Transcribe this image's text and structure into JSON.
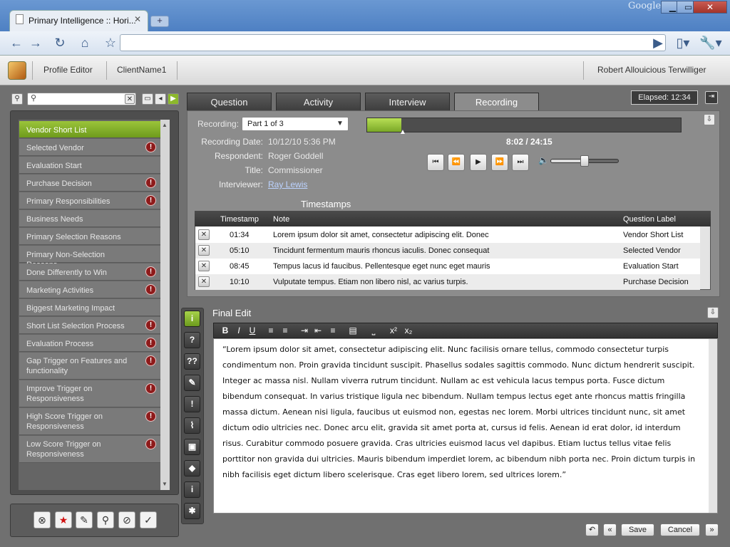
{
  "browser": {
    "tab_title": "Primary Intelligence :: Hori...",
    "brand": "Google",
    "address": "",
    "window_controls": [
      "▁",
      "▭",
      "✕"
    ]
  },
  "header": {
    "profile_editor": "Profile Editor",
    "client_name": "ClientName1",
    "user_name": "Robert Allouicious Terwilliger"
  },
  "sidebar": {
    "search_placeholder": "",
    "items": [
      {
        "label": "Vendor Short List",
        "warn": false,
        "selected": true
      },
      {
        "label": "Selected Vendor",
        "warn": true
      },
      {
        "label": "Evaluation Start",
        "warn": false
      },
      {
        "label": "Purchase Decision",
        "warn": true
      },
      {
        "label": "Primary Responsibilities",
        "warn": true
      },
      {
        "label": "Business Needs",
        "warn": false
      },
      {
        "label": "Primary Selection Reasons",
        "warn": false
      },
      {
        "label": "Primary Non-Selection Reasons",
        "warn": false
      },
      {
        "label": "Done Differently to Win",
        "warn": true
      },
      {
        "label": "Marketing Activities",
        "warn": true
      },
      {
        "label": "Biggest Marketing Impact",
        "warn": false
      },
      {
        "label": "Short List Selection Process",
        "warn": true
      },
      {
        "label": "Evaluation Process",
        "warn": true
      },
      {
        "label": "Gap Trigger on Features and functionality",
        "warn": true
      },
      {
        "label": "Improve Trigger on Responsiveness",
        "warn": true
      },
      {
        "label": "High Score Trigger on Responsiveness",
        "warn": true
      },
      {
        "label": "Low Score Trigger on Responsiveness",
        "warn": true
      }
    ]
  },
  "tabs": [
    "Question",
    "Activity",
    "Interview",
    "Recording"
  ],
  "active_tab": "Recording",
  "elapsed": "Elapsed: 12:34",
  "recording": {
    "label": "Recording:",
    "part": "Part 1 of 3",
    "time": "8:02 / 24:15",
    "progress": 0.11,
    "volume": 0.48,
    "fields": {
      "date_label": "Recording Date:",
      "date": "10/12/10  5:36 PM",
      "respondent_label": "Respondent:",
      "respondent": "Roger Goddell",
      "title_label": "Title:",
      "title": "Commissioner",
      "interviewer_label": "Interviewer:",
      "interviewer": "Ray Lewis"
    }
  },
  "timestamps": {
    "heading": "Timestamps",
    "columns": [
      "Timestamp",
      "Note",
      "Question Label"
    ],
    "rows": [
      {
        "time": "01:34",
        "note": "Lorem ipsum dolor sit amet, consectetur adipiscing elit. Donec",
        "label": "Vendor Short List"
      },
      {
        "time": "05:10",
        "note": "Tincidunt fermentum mauris rhoncus iaculis. Donec consequat",
        "label": "Selected Vendor"
      },
      {
        "time": "08:45",
        "note": "Tempus lacus id faucibus. Pellentesque eget nunc eget mauris",
        "label": "Evaluation Start"
      },
      {
        "time": "10:10",
        "note": "Vulputate tempus. Etiam non libero nisl, ac varius turpis.",
        "label": "Purchase Decision"
      }
    ]
  },
  "final_edit": {
    "heading": "Final Edit",
    "toolbar": [
      "B",
      "I",
      "U",
      "≡",
      "≡",
      "⇥",
      "⇤",
      "≡",
      "▤",
      "⎵",
      "x²",
      "x₂"
    ],
    "text": "“Lorem ipsum dolor sit amet, consectetur adipiscing elit. Nunc facilisis ornare tellus, commodo consectetur turpis condimentum non. Proin gravida tincidunt suscipit. Phasellus sodales sagittis commodo. Nunc dictum hendrerit suscipit. Integer ac massa nisl. Nullam viverra rutrum tincidunt. Nullam ac est vehicula lacus tempus porta. Fusce dictum bibendum consequat. In varius tristique ligula nec bibendum. Nullam tempus lectus eget ante rhoncus mattis fringilla massa dictum. Aenean nisi ligula, faucibus ut euismod non, egestas nec lorem. Morbi ultrices tincidunt nunc, sit amet dictum odio ultricies nec. Donec arcu elit, gravida sit amet porta at, cursus id felis. Aenean id erat dolor, id interdum risus. Curabitur commodo posuere gravida. Cras ultricies euismod lacus vel dapibus. Etiam luctus tellus vitae felis porttitor non gravida dui ultricies. Mauris bibendum imperdiet lorem, ac bibendum nibh porta nec. Proin dictum turpis in nibh facilisis eget dictum libero scelerisque. Cras eget libero lorem, sed ultrices lorem.”"
  },
  "footer": {
    "save": "Save",
    "cancel": "Cancel"
  },
  "vertical_tools": [
    "i",
    "?",
    "??",
    "✎",
    "!",
    "⌇",
    "▣",
    "◆",
    "i",
    "✱"
  ],
  "colors": {
    "accent_green": "#8cb82c",
    "warn_red": "#8e1b1b",
    "dark_panel": "#4e4e4e"
  }
}
